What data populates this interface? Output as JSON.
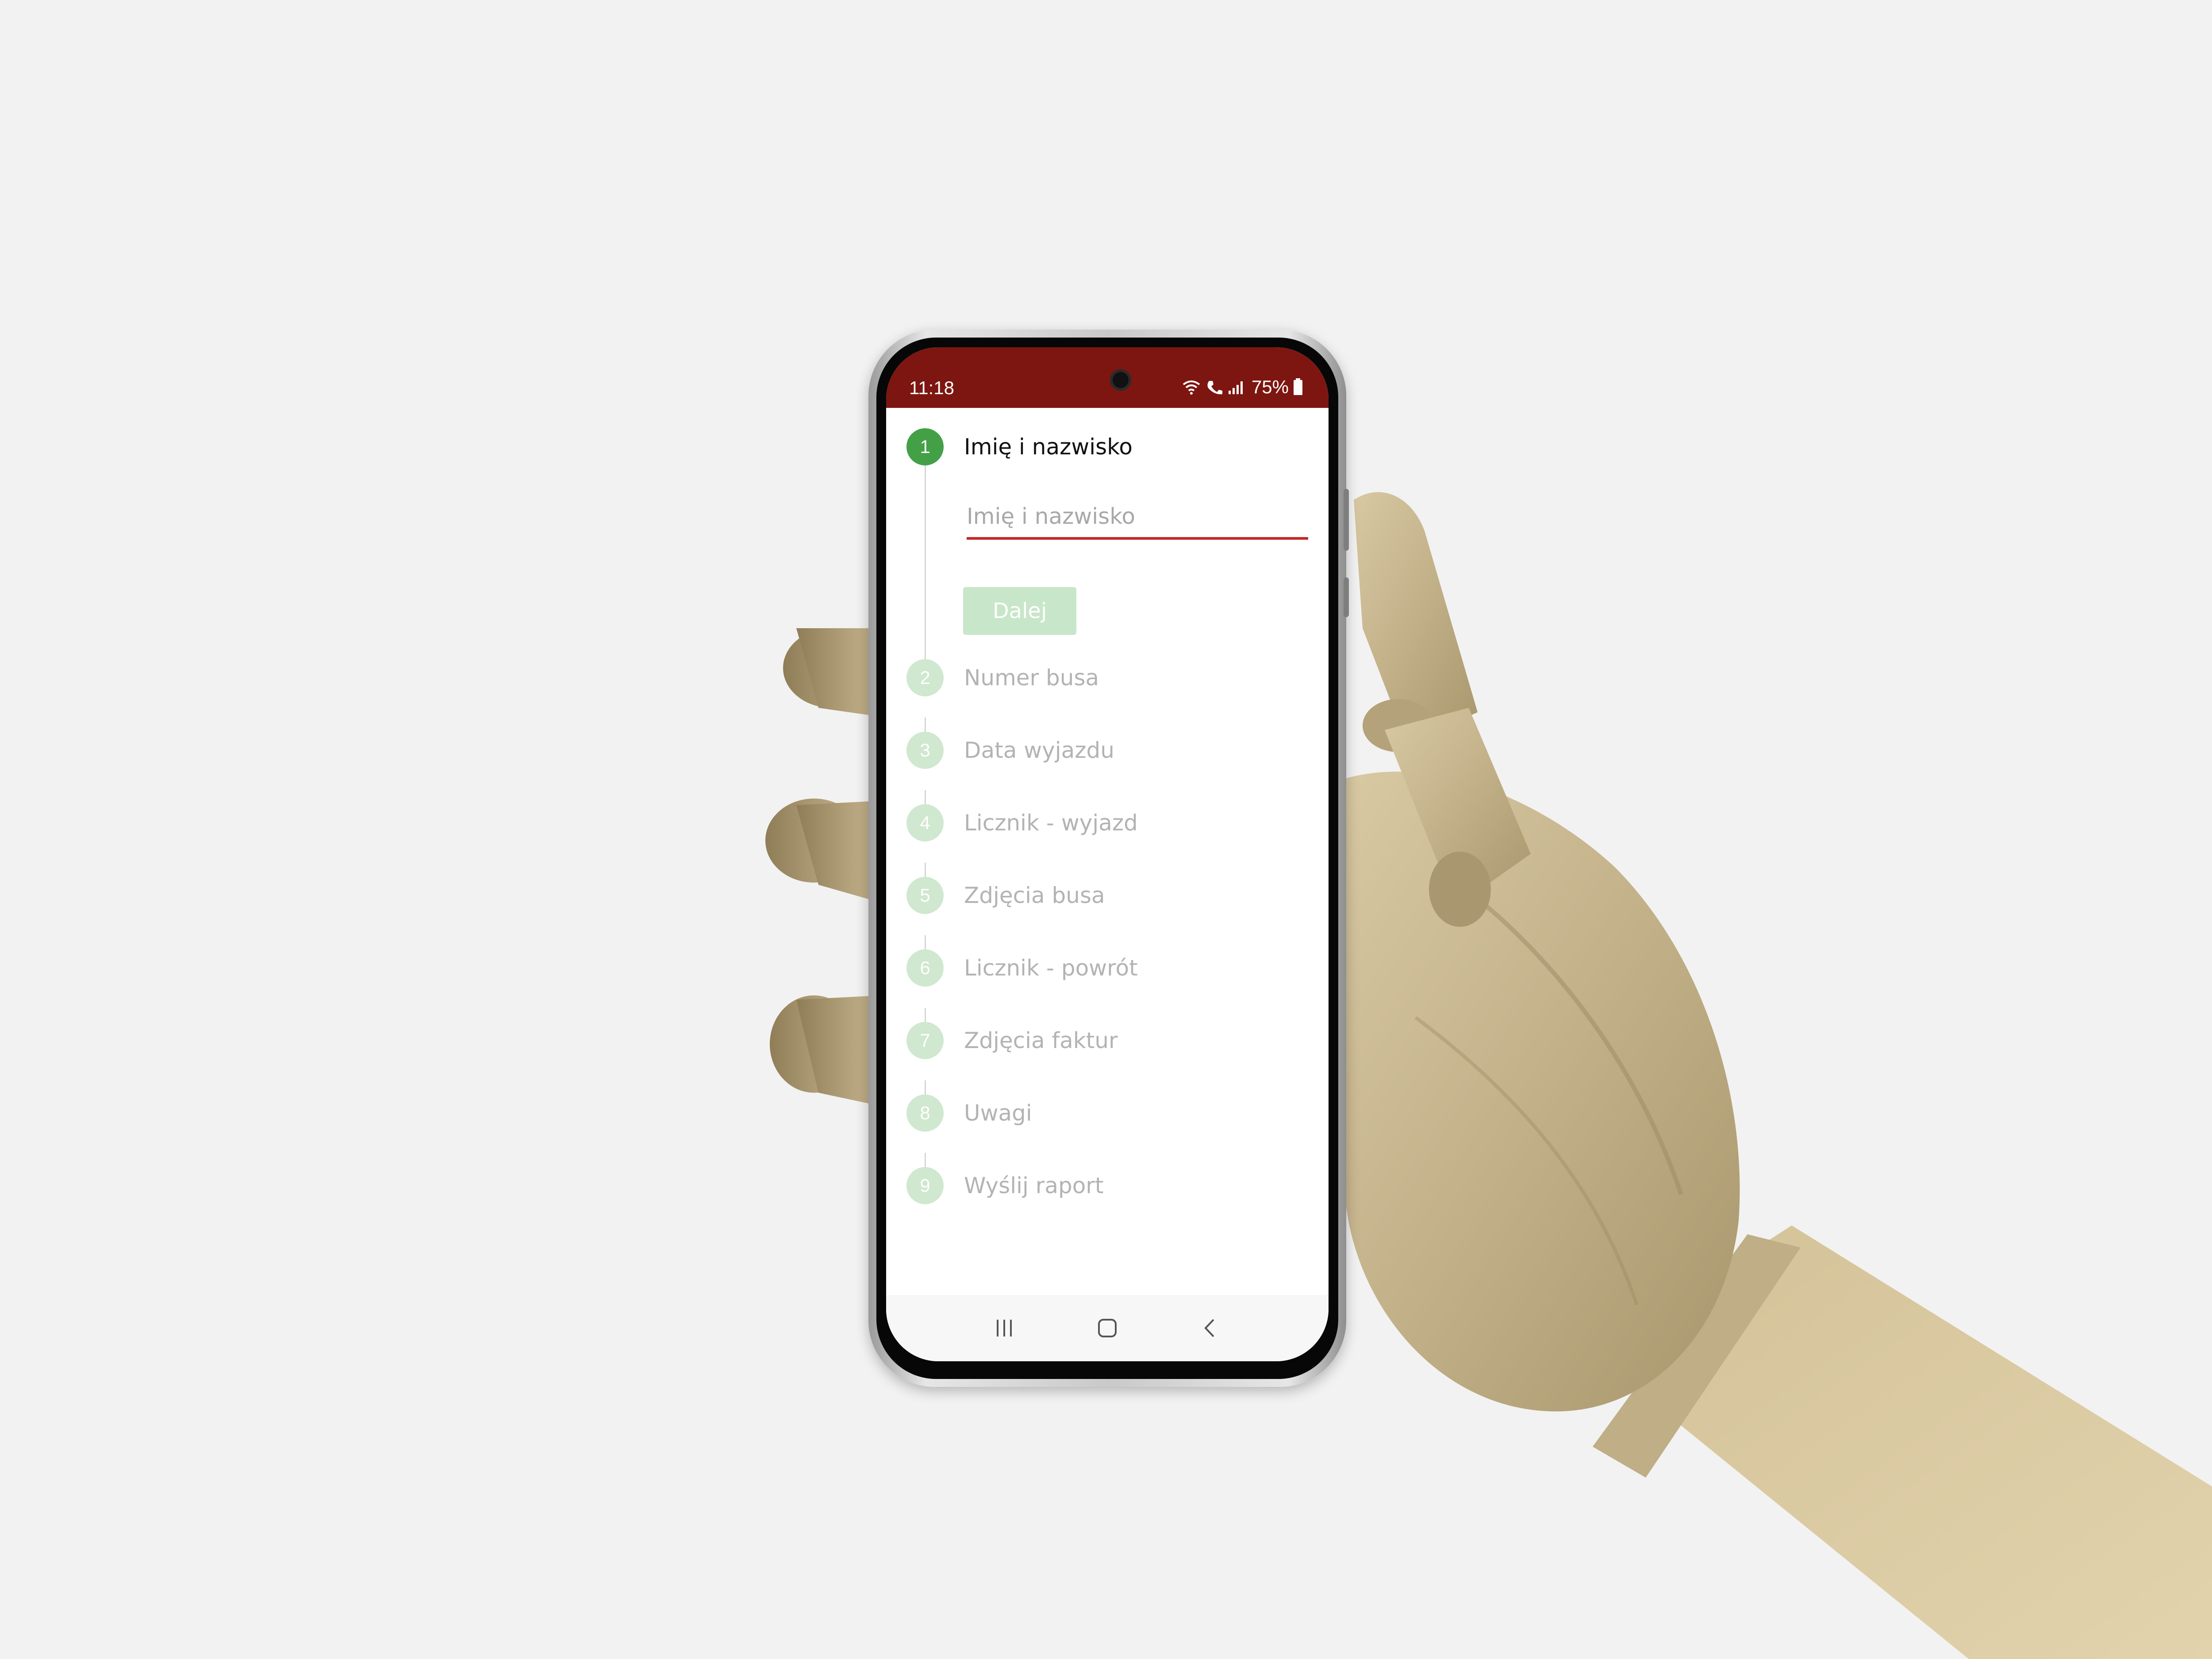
{
  "status_bar": {
    "time": "11:18",
    "battery": "75%",
    "background_color": "#7d1610",
    "icons": [
      "wifi-icon",
      "call-icon",
      "signal-icon",
      "battery-icon"
    ]
  },
  "stepper": {
    "active_color": "#43a047",
    "inactive_color": "#cfe8cf",
    "steps": [
      {
        "number": "1",
        "label": "Imię i nazwisko"
      },
      {
        "number": "2",
        "label": "Numer busa"
      },
      {
        "number": "3",
        "label": "Data wyjazdu"
      },
      {
        "number": "4",
        "label": "Licznik - wyjazd"
      },
      {
        "number": "5",
        "label": "Zdjęcia busa"
      },
      {
        "number": "6",
        "label": "Licznik - powrót"
      },
      {
        "number": "7",
        "label": "Zdjęcia faktur"
      },
      {
        "number": "8",
        "label": "Uwagi"
      },
      {
        "number": "9",
        "label": "Wyślij raport"
      }
    ],
    "current_step": 1
  },
  "form": {
    "name_input": {
      "placeholder": "Imię i nazwisko",
      "value": "",
      "underline_color": "#c62828"
    },
    "next_button_label": "Dalej"
  },
  "nav_bar": {
    "icons": [
      "recent-apps-icon",
      "home-icon",
      "back-icon"
    ]
  }
}
